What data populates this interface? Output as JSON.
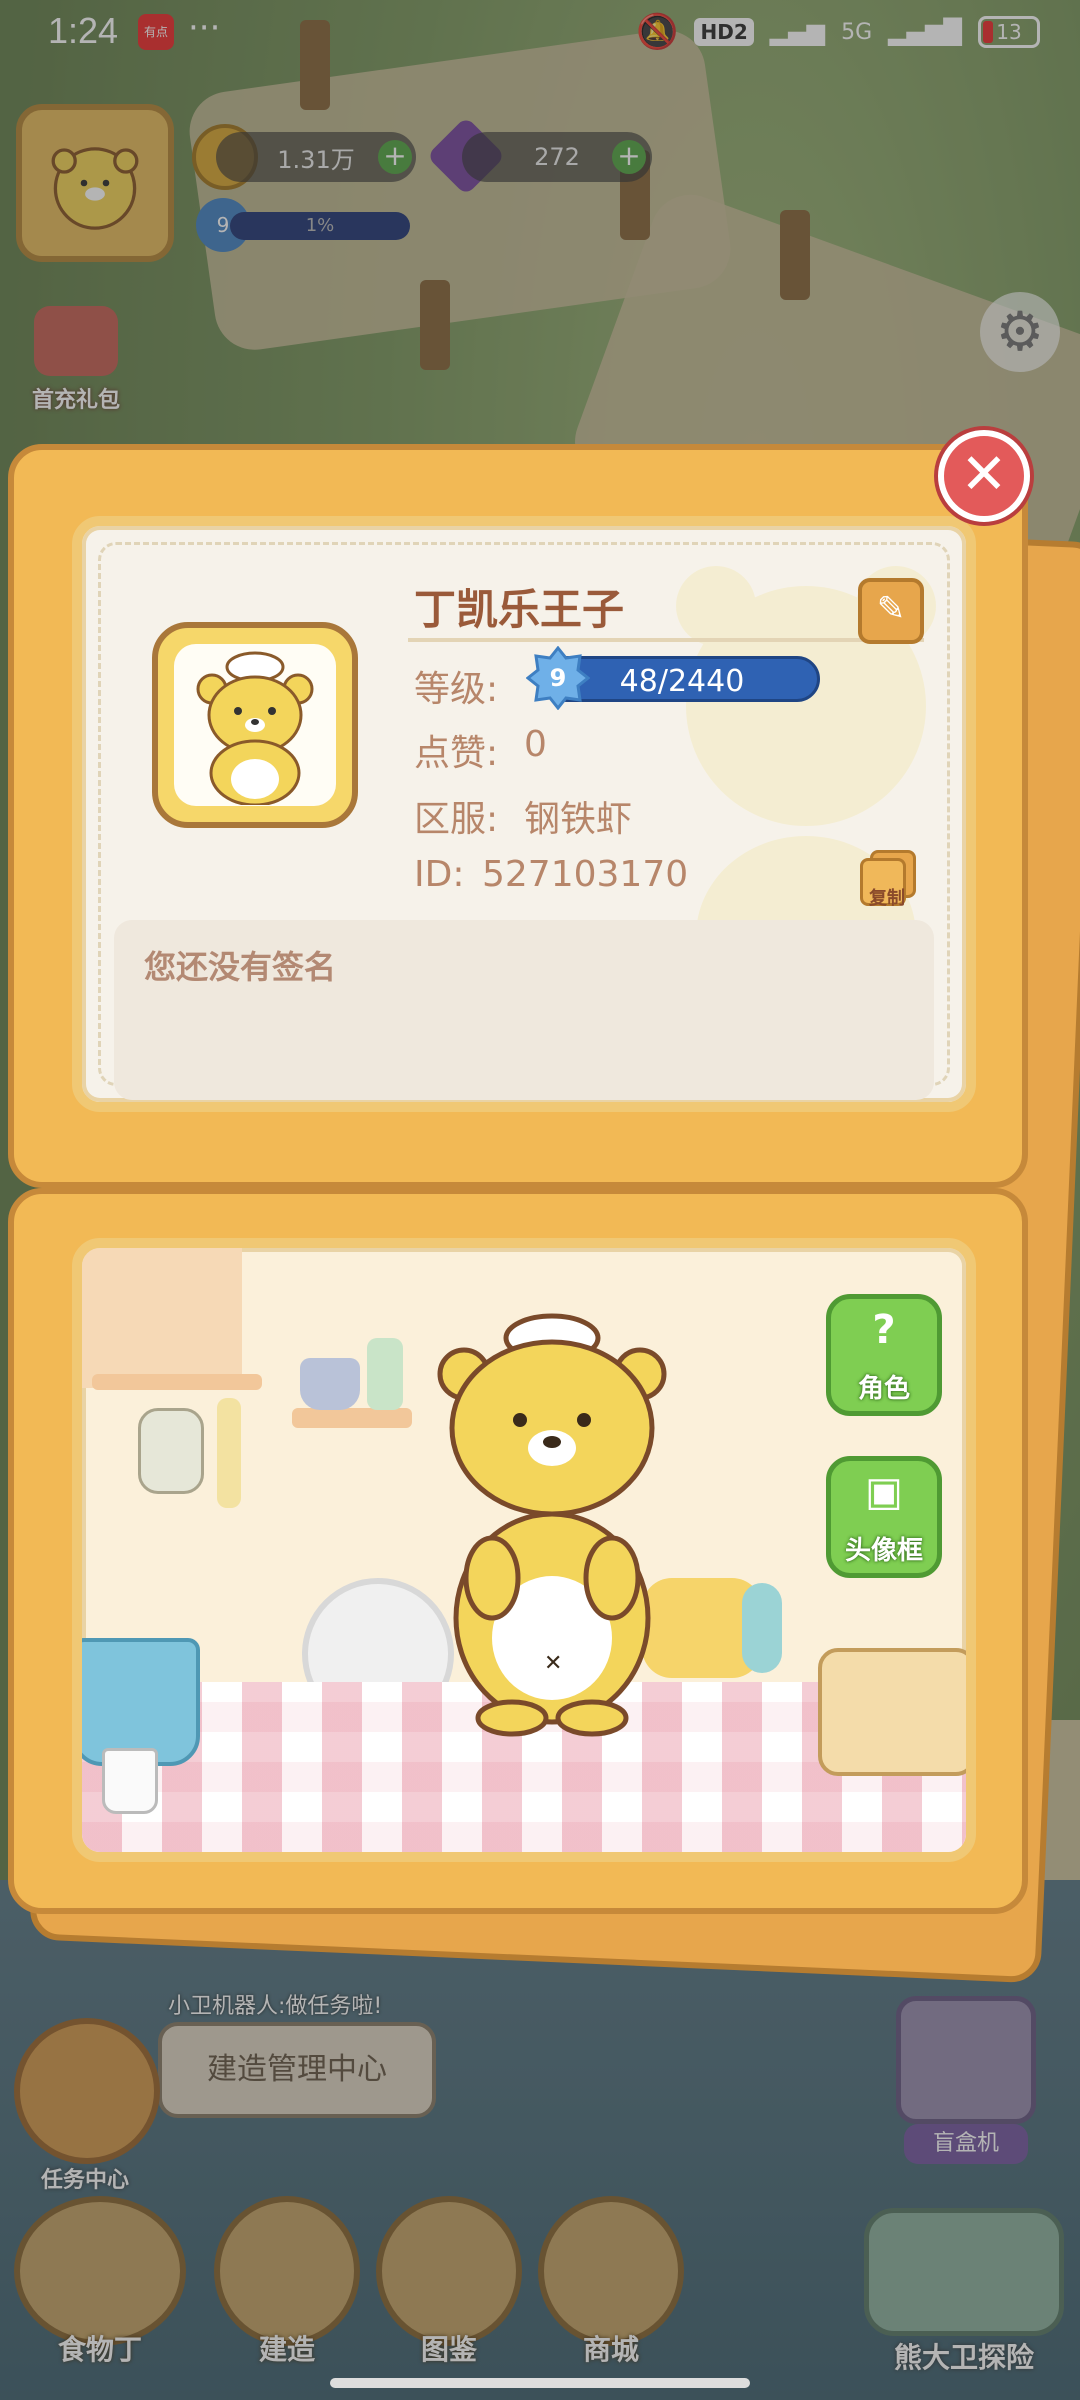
{
  "status_bar": {
    "time": "1:24",
    "notif_app_label": "有点",
    "more_dots": "···",
    "network_hd": "HD2",
    "network_5g": "5G",
    "battery": "13"
  },
  "hud": {
    "coins": "1.31万",
    "gems": "272",
    "player_level": "9",
    "exp_percent": "1%",
    "first_charge_gift_label": "首充礼包",
    "gear_icon": "gear-icon"
  },
  "profile": {
    "name": "丁凯乐王子",
    "level_label": "等级:",
    "level_number": "9",
    "level_progress": "48/2440",
    "likes_label": "点赞:",
    "likes_value": "0",
    "server_label": "区服:",
    "server_value": "钢铁虾",
    "id_label": "ID:",
    "id_value": "527103170",
    "copy_label": "复制",
    "signature_placeholder": "您还没有签名"
  },
  "room": {
    "character_button_label": "角色",
    "avatar_frame_button_label": "头像框"
  },
  "bottom_hud": {
    "robot_tip": "小卫机器人:做任务啦!",
    "robot_bubble": "建造管理中心",
    "task_center_label": "任务中心",
    "blind_box_label": "盲盒机",
    "bottom_buttons": [
      "食物丁",
      "建造",
      "图鉴",
      "商城"
    ],
    "bear_explore_label": "熊大卫探险"
  },
  "colors": {
    "panel_orange": "#f2b955",
    "level_bar_blue": "#2f62b3",
    "close_red": "#e35a5a",
    "side_button_green": "#7fce52"
  }
}
